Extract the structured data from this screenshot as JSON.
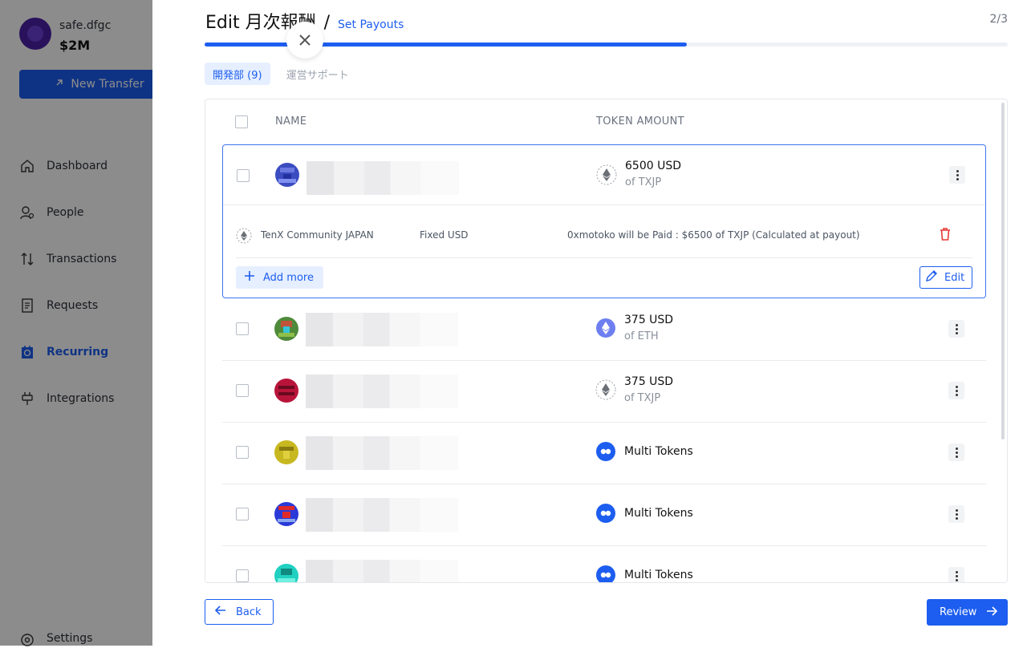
{
  "sidebar": {
    "safe_name": "safe.dfgc",
    "safe_balance": "$2M",
    "new_transfer_label": "New Transfer",
    "nav": [
      {
        "label": "Dashboard",
        "icon": "home-icon"
      },
      {
        "label": "People",
        "icon": "people-icon"
      },
      {
        "label": "Transactions",
        "icon": "transactions-icon"
      },
      {
        "label": "Requests",
        "icon": "requests-icon"
      },
      {
        "label": "Recurring",
        "icon": "recurring-icon",
        "active": true
      },
      {
        "label": "Integrations",
        "icon": "integrations-icon"
      }
    ],
    "settings_label": "Settings"
  },
  "drawer": {
    "title": "Edit 月次報酬",
    "separator": "/",
    "crumb": "Set Payouts",
    "step": "2/3",
    "progress_fraction": 0.6,
    "tabs": [
      {
        "label": "開発部 (9)",
        "active": true
      },
      {
        "label": "運営サポート",
        "active": false
      }
    ],
    "columns": {
      "name": "NAME",
      "token_amount": "TOKEN AMOUNT"
    },
    "rows": [
      {
        "amount": "6500 USD",
        "sub": "of TXJP",
        "token": "txjp-icon"
      },
      {
        "amount": "375 USD",
        "sub": "of ETH",
        "token": "eth-icon"
      },
      {
        "amount": "375 USD",
        "sub": "of TXJP",
        "token": "txjp-icon"
      },
      {
        "amount": "Multi Tokens",
        "sub": "",
        "token": "multi-token-icon"
      },
      {
        "amount": "Multi Tokens",
        "sub": "",
        "token": "multi-token-icon"
      },
      {
        "amount": "Multi Tokens",
        "sub": "",
        "token": "multi-token-icon"
      }
    ],
    "detail": {
      "token_name": "TenX Community JAPAN",
      "type": "Fixed USD",
      "description": "0xmotoko will be Paid : $6500 of TXJP (Calculated at payout)"
    },
    "add_more_label": "Add more",
    "edit_label": "Edit",
    "back_label": "Back",
    "review_label": "Review"
  },
  "colors": {
    "accent": "#1d5ef0",
    "danger": "#e53935"
  }
}
